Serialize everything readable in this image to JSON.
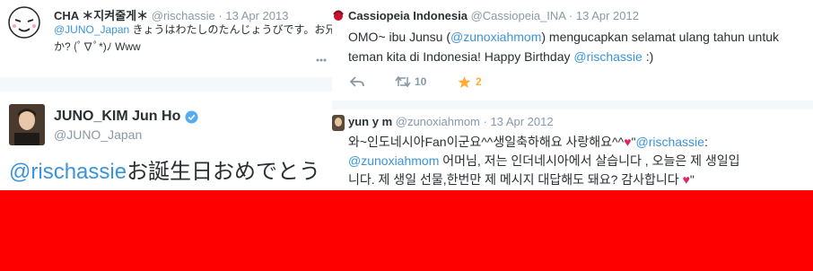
{
  "tweet_cha": {
    "name": "CHA ＊지켜줄게＊",
    "handle": "@rischassie",
    "date": "13 Apr 2013",
    "mention": "@JUNO_Japan",
    "text_line1": " きょうはわたしのたんじょうびです。お兄さ",
    "text_line2": "か? (ﾟ∇ﾟ*)ﾉ Www"
  },
  "tweet_juno": {
    "name": "JUNO_KIM Jun Ho",
    "handle": "@JUNO_Japan",
    "mention": "@rischassie",
    "text": "お誕生日おめでとう"
  },
  "tweet_cassiopeia": {
    "name": "Cassiopeia Indonesia",
    "handle": "@Cassiopeia_INA",
    "date": "13 Apr 2012",
    "text_a": "OMO~ ibu Junsu (",
    "mention_a": "@zunoxiahmom",
    "text_b": ") mengucapkan selamat ulang tahun untuk",
    "text_c": "teman kita di Indonesia! Happy Birthday ",
    "mention_b": "@rischassie",
    "text_d": " :)",
    "retweet_count": "10",
    "favorite_count": "2"
  },
  "tweet_yun": {
    "name": "yun y m",
    "handle": "@zunoxiahmom",
    "date": "13 Apr 2012",
    "line1_a": "와~인도네시아Fan이군요^^생일축하해요  사랑해요^^",
    "line1_b": "\"",
    "line1_mention": "@rischassie",
    "line1_c": ":",
    "line2_mention": "@zunoxiahmom",
    "line2_text": " 어머님, 저는 인더네시아에서 살습니다 , 오늘은 제 생일입",
    "line3_text": "니다. 제 생일 선물,한번만 제 메시지 대답해도 돼요? 감사합니다 ",
    "line3_end": "\""
  },
  "colors": {
    "link": "#3b94d9",
    "muted": "#8899a6",
    "verified": "#55acee",
    "heart": "#e0245e",
    "star": "#ffac33",
    "band": "#ff0000"
  }
}
